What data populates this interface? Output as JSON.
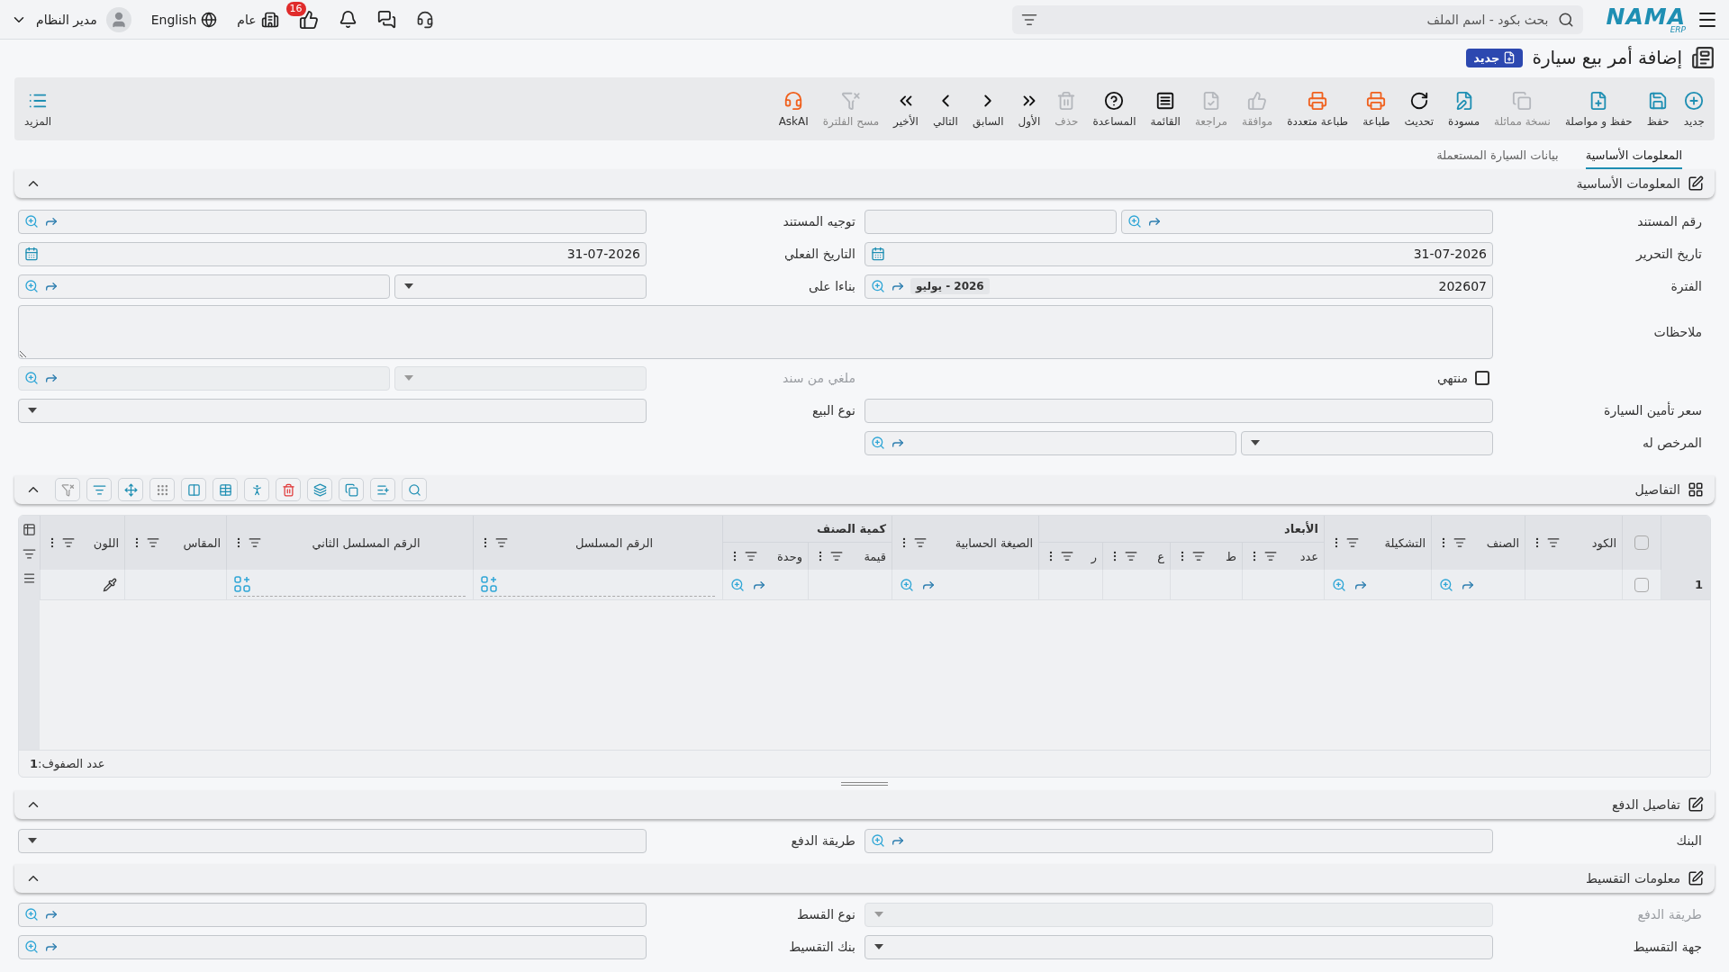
{
  "topbar": {
    "logo": {
      "name": "NAMA",
      "sub": "ERP"
    },
    "search": {
      "placeholder": "بحث بكود - اسم الملف"
    },
    "badge": "16",
    "branch": "عام",
    "language": "English",
    "user": "مدير النظام"
  },
  "page": {
    "title": "إضافة أمر بيع سيارة",
    "status": "جديد"
  },
  "toolbar": {
    "actions": [
      {
        "label": "جديد",
        "disabled": false
      },
      {
        "label": "حفظ",
        "disabled": false
      },
      {
        "label": "حفظ و مواصلة",
        "disabled": false
      },
      {
        "label": "نسخة مماثلة",
        "disabled": true
      },
      {
        "label": "مسودة",
        "disabled": false
      },
      {
        "label": "تحديث",
        "disabled": false
      },
      {
        "label": "طباعة",
        "disabled": false
      },
      {
        "label": "طباعة متعددة",
        "disabled": false
      },
      {
        "label": "موافقة",
        "disabled": true
      },
      {
        "label": "مراجعة",
        "disabled": true
      },
      {
        "label": "القائمة",
        "disabled": false
      },
      {
        "label": "المساعدة",
        "disabled": false
      },
      {
        "label": "حذف",
        "disabled": true
      },
      {
        "label": "الأول",
        "disabled": false
      },
      {
        "label": "السابق",
        "disabled": false
      },
      {
        "label": "التالي",
        "disabled": false
      },
      {
        "label": "الأخير",
        "disabled": false
      },
      {
        "label": "مسح الفلترة",
        "disabled": true
      },
      {
        "label": "AskAI",
        "disabled": false
      }
    ],
    "more": "المزيد"
  },
  "tabs": [
    {
      "label": "المعلومات الأساسية",
      "selected": true
    },
    {
      "label": "بيانات السيارة المستعملة",
      "selected": false
    }
  ],
  "sections": [
    {
      "kind": "form",
      "title": "المعلومات الأساسية",
      "expanded": true,
      "rows": [
        [
          {
            "kind": "field",
            "label": "رقم المستند",
            "disabled": false,
            "controls": [
              {
                "kind": "lookup"
              },
              {
                "kind": "text"
              }
            ]
          },
          {
            "kind": "field",
            "label": "توجيه المستند",
            "disabled": false,
            "controls": [
              {
                "kind": "lookup"
              }
            ]
          }
        ],
        [
          {
            "kind": "field",
            "label": "تاريخ التحرير",
            "disabled": false,
            "controls": [
              {
                "kind": "date",
                "value": "31-07-2026"
              }
            ]
          },
          {
            "kind": "field",
            "label": "التاريخ الفعلي",
            "disabled": false,
            "controls": [
              {
                "kind": "date",
                "value": "31-07-2026"
              }
            ]
          }
        ],
        [
          {
            "kind": "field",
            "label": "الفترة",
            "disabled": false,
            "controls": [
              {
                "kind": "lookup",
                "value": "202607",
                "chip": "2026 - يوليو"
              }
            ]
          },
          {
            "kind": "field",
            "label": "بناءا على",
            "disabled": false,
            "controls": [
              {
                "kind": "select"
              },
              {
                "kind": "lookup"
              }
            ]
          }
        ],
        [
          {
            "kind": "textarea",
            "label": "ملاحظات"
          }
        ],
        [
          {
            "kind": "checkbox",
            "label": "منتهي",
            "checked": false
          },
          {
            "kind": "field",
            "label": "ملغي من سند",
            "disabled": true,
            "controls": [
              {
                "kind": "select"
              },
              {
                "kind": "lookup"
              }
            ]
          }
        ],
        [
          {
            "kind": "field",
            "label": "سعر تأمين السيارة",
            "disabled": false,
            "controls": [
              {
                "kind": "text"
              }
            ]
          },
          {
            "kind": "field",
            "label": "نوع البيع",
            "disabled": false,
            "controls": [
              {
                "kind": "select"
              }
            ]
          }
        ],
        [
          {
            "kind": "field",
            "label": "المرخص له",
            "disabled": false,
            "controls": [
              {
                "kind": "select"
              },
              {
                "kind": "lookup"
              }
            ]
          }
        ]
      ]
    },
    {
      "kind": "grid",
      "title": "التفاصيل",
      "expanded": true,
      "all_selected": false,
      "columns": [
        {
          "label": "الكود",
          "kind": "text"
        },
        {
          "label": "الصنف",
          "kind": "lookup"
        },
        {
          "label": "التشكيلة",
          "kind": "lookup"
        },
        {
          "group": "الأبعاد",
          "children": [
            {
              "label": "عدد",
              "kind": "text"
            },
            {
              "label": "ط",
              "kind": "text"
            },
            {
              "label": "ع",
              "kind": "text"
            },
            {
              "label": "ر",
              "kind": "text"
            }
          ]
        },
        {
          "label": "الصيغة الحسابية",
          "kind": "lookup"
        },
        {
          "group": "كمية الصنف",
          "children": [
            {
              "label": "قيمة",
              "kind": "text"
            },
            {
              "label": "وحدة",
              "kind": "lookup"
            }
          ]
        },
        {
          "label": "الرقم المسلسل",
          "kind": "serial"
        },
        {
          "label": "الرقم المسلسل الثاني",
          "kind": "serial"
        },
        {
          "label": "المقاس",
          "kind": "text"
        },
        {
          "label": "اللون",
          "kind": "color"
        }
      ],
      "rows": [
        {
          "number": "1",
          "checked": false
        }
      ],
      "footer": "عدد الصفوف:**1**"
    },
    {
      "kind": "form",
      "title": "تفاصيل الدفع",
      "expanded": true,
      "rows": [
        [
          {
            "kind": "field",
            "label": "البنك",
            "disabled": false,
            "controls": [
              {
                "kind": "lookup"
              }
            ]
          },
          {
            "kind": "field",
            "label": "طريقة الدفع",
            "disabled": false,
            "controls": [
              {
                "kind": "select"
              }
            ]
          }
        ]
      ]
    },
    {
      "kind": "form",
      "title": "معلومات التقسيط",
      "expanded": true,
      "rows": [
        [
          {
            "kind": "field",
            "label": "طريقة الدفع",
            "disabled": true,
            "controls": [
              {
                "kind": "select"
              }
            ]
          },
          {
            "kind": "field",
            "label": "نوع القسط",
            "disabled": false,
            "controls": [
              {
                "kind": "lookup"
              }
            ]
          }
        ],
        [
          {
            "kind": "field",
            "label": "جهة التقسيط",
            "disabled": false,
            "controls": [
              {
                "kind": "select"
              }
            ]
          },
          {
            "kind": "field",
            "label": "بنك التقسيط",
            "disabled": false,
            "controls": [
              {
                "kind": "lookup"
              }
            ]
          }
        ]
      ]
    }
  ]
}
